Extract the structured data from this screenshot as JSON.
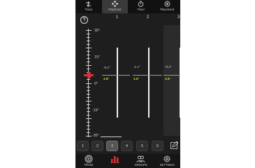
{
  "top_tabs": [
    {
      "label": "Trace",
      "icon": "arrows-icon"
    },
    {
      "label": "Poly/Cont",
      "icon": "dots-icon"
    },
    {
      "label": "Timer",
      "icon": "stopwatch-icon"
    },
    {
      "label": "Placement",
      "icon": "target-icon"
    }
  ],
  "active_top_tab": "Poly/Cont",
  "help_label": "?",
  "columns": [
    {
      "number": "1",
      "top_value": "-0.1°",
      "bottom_value": "3.8°"
    },
    {
      "number": "2",
      "top_value": "-1.1°",
      "bottom_value": "3.5°"
    },
    {
      "number": "3",
      "top_value": "-0.2°",
      "bottom_value": "3.6°"
    }
  ],
  "scale_labels": [
    "30°",
    "15°",
    "0°",
    "-15°",
    "-30°"
  ],
  "number_buttons": [
    "1",
    "2",
    "3",
    "4",
    "5",
    "6"
  ],
  "active_number": "3",
  "bottom_nav": [
    {
      "label": "TRAIN",
      "icon": "target-icon"
    },
    {
      "label": "",
      "icon": "bar-chart-icon"
    },
    {
      "label": "GROUPS",
      "icon": "group-icon"
    },
    {
      "label": "SETTINGS",
      "icon": "gear-icon"
    }
  ],
  "colors": {
    "background": "#1e1e1e",
    "accent_red": "#d9303a",
    "value_yellow": "#c6d63a",
    "bar_white": "#f2f2f2"
  }
}
